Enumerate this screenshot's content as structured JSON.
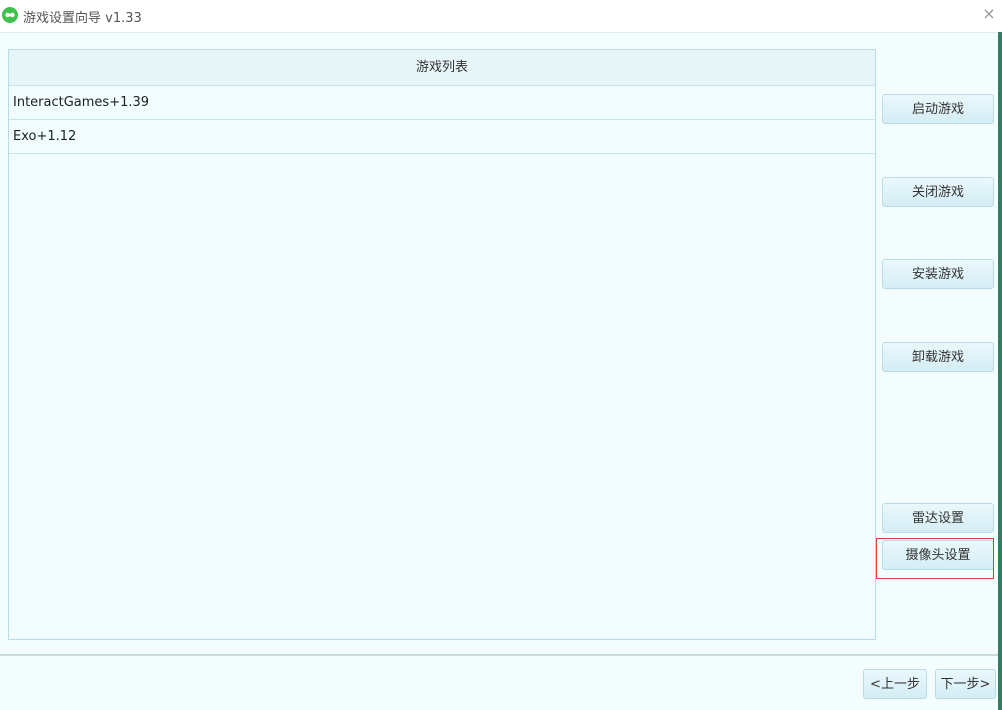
{
  "window": {
    "title": "游戏设置向导 v1.33",
    "close_glyph": "×"
  },
  "game_list": {
    "header": "游戏列表",
    "items": [
      "InteractGames+1.39",
      "Exo+1.12"
    ]
  },
  "side_buttons": {
    "start": "启动游戏",
    "close": "关闭游戏",
    "install": "安装游戏",
    "uninstall": "卸载游戏",
    "radar": "雷达设置",
    "camera": "摄像头设置"
  },
  "nav": {
    "prev": "<上一步",
    "next": "下一步>"
  },
  "colors": {
    "accent": "#3fc24c",
    "highlight": "#e53935",
    "window_border": "#2f7f62"
  }
}
